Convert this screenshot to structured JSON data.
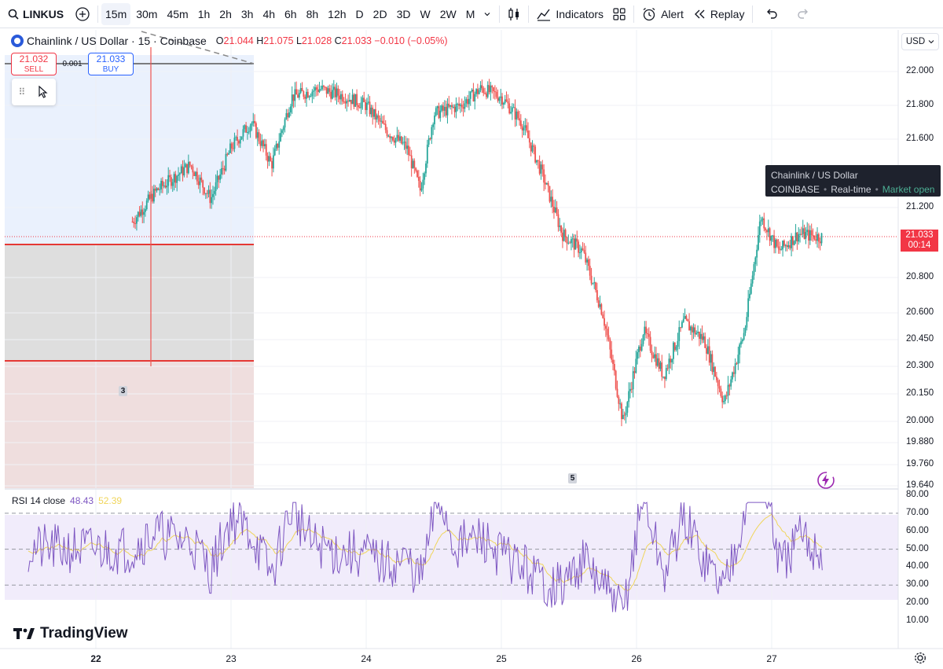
{
  "toolbar": {
    "symbol": "LINKUSD",
    "timeframes": [
      "15m",
      "30m",
      "45m",
      "1h",
      "2h",
      "3h",
      "4h",
      "6h",
      "8h",
      "12h",
      "D",
      "2D",
      "3D",
      "W",
      "2W",
      "M"
    ],
    "active_timeframe": "15m",
    "indicators_label": "Indicators",
    "alert_label": "Alert",
    "replay_label": "Replay"
  },
  "legend": {
    "title": "Chainlink / US Dollar · 15 · Coinbase",
    "o_label": "O",
    "o_value": "21.044",
    "h_label": "H",
    "h_value": "21.075",
    "l_label": "L",
    "l_value": "21.028",
    "c_label": "C",
    "c_value": "21.033",
    "change": "−0.010 (−0.05%)"
  },
  "trade": {
    "sell_price": "21.032",
    "sell_label": "SELL",
    "spread": "0.001",
    "buy_price": "21.033",
    "buy_label": "BUY"
  },
  "price_axis": {
    "currency": "USD",
    "labels": [
      "22.000",
      "21.800",
      "21.600",
      "21.200",
      "20.800",
      "20.600",
      "20.450",
      "20.300",
      "20.150",
      "20.000",
      "19.880",
      "19.760",
      "19.640"
    ],
    "current_price": "21.033",
    "countdown": "00:14"
  },
  "tooltip": {
    "line1": "Chainlink / US Dollar",
    "exchange": "COINBASE",
    "realtime": "Real-time",
    "status": "Market open"
  },
  "rsi": {
    "label": "RSI 14 close",
    "value": "48.43",
    "ma_value": "52.39",
    "axis_labels": [
      "80.00",
      "70.00",
      "60.00",
      "50.00",
      "40.00",
      "30.00",
      "20.00",
      "10.00"
    ]
  },
  "markers": [
    "3",
    "5"
  ],
  "time_axis": [
    "22",
    "23",
    "24",
    "25",
    "26",
    "27"
  ],
  "brand": "TradingView",
  "colors": {
    "up": "#26a69a",
    "down": "#ef5350",
    "rsi": "#7e57c2",
    "rsi_ma": "#f0d55a"
  },
  "chart_data": {
    "type": "candlestick",
    "days": [
      "22",
      "23",
      "24",
      "25",
      "26",
      "27"
    ],
    "price_range": [
      19.64,
      22.1
    ],
    "close_path": [
      [
        22.0,
        21.98
      ],
      [
        22.2,
        21.05
      ],
      [
        22.45,
        21.3
      ],
      [
        22.7,
        21.45
      ],
      [
        22.85,
        21.25
      ],
      [
        23.0,
        21.55
      ],
      [
        23.15,
        21.7
      ],
      [
        23.3,
        21.45
      ],
      [
        23.45,
        21.85
      ],
      [
        23.65,
        21.9
      ],
      [
        23.85,
        21.85
      ],
      [
        24.0,
        21.8
      ],
      [
        24.15,
        21.65
      ],
      [
        24.3,
        21.55
      ],
      [
        24.4,
        21.3
      ],
      [
        24.5,
        21.75
      ],
      [
        24.7,
        21.8
      ],
      [
        24.85,
        21.9
      ],
      [
        25.0,
        21.85
      ],
      [
        25.15,
        21.7
      ],
      [
        25.3,
        21.4
      ],
      [
        25.45,
        21.05
      ],
      [
        25.6,
        20.95
      ],
      [
        25.75,
        20.6
      ],
      [
        25.9,
        20.0
      ],
      [
        26.05,
        20.5
      ],
      [
        26.2,
        20.25
      ],
      [
        26.35,
        20.55
      ],
      [
        26.5,
        20.45
      ],
      [
        26.65,
        20.1
      ],
      [
        26.8,
        20.5
      ],
      [
        26.92,
        21.15
      ],
      [
        27.05,
        20.95
      ],
      [
        27.2,
        21.05
      ],
      [
        27.38,
        21.03
      ]
    ],
    "rsi_range": [
      10,
      80
    ],
    "rsi_levels": [
      70,
      50,
      30
    ]
  }
}
